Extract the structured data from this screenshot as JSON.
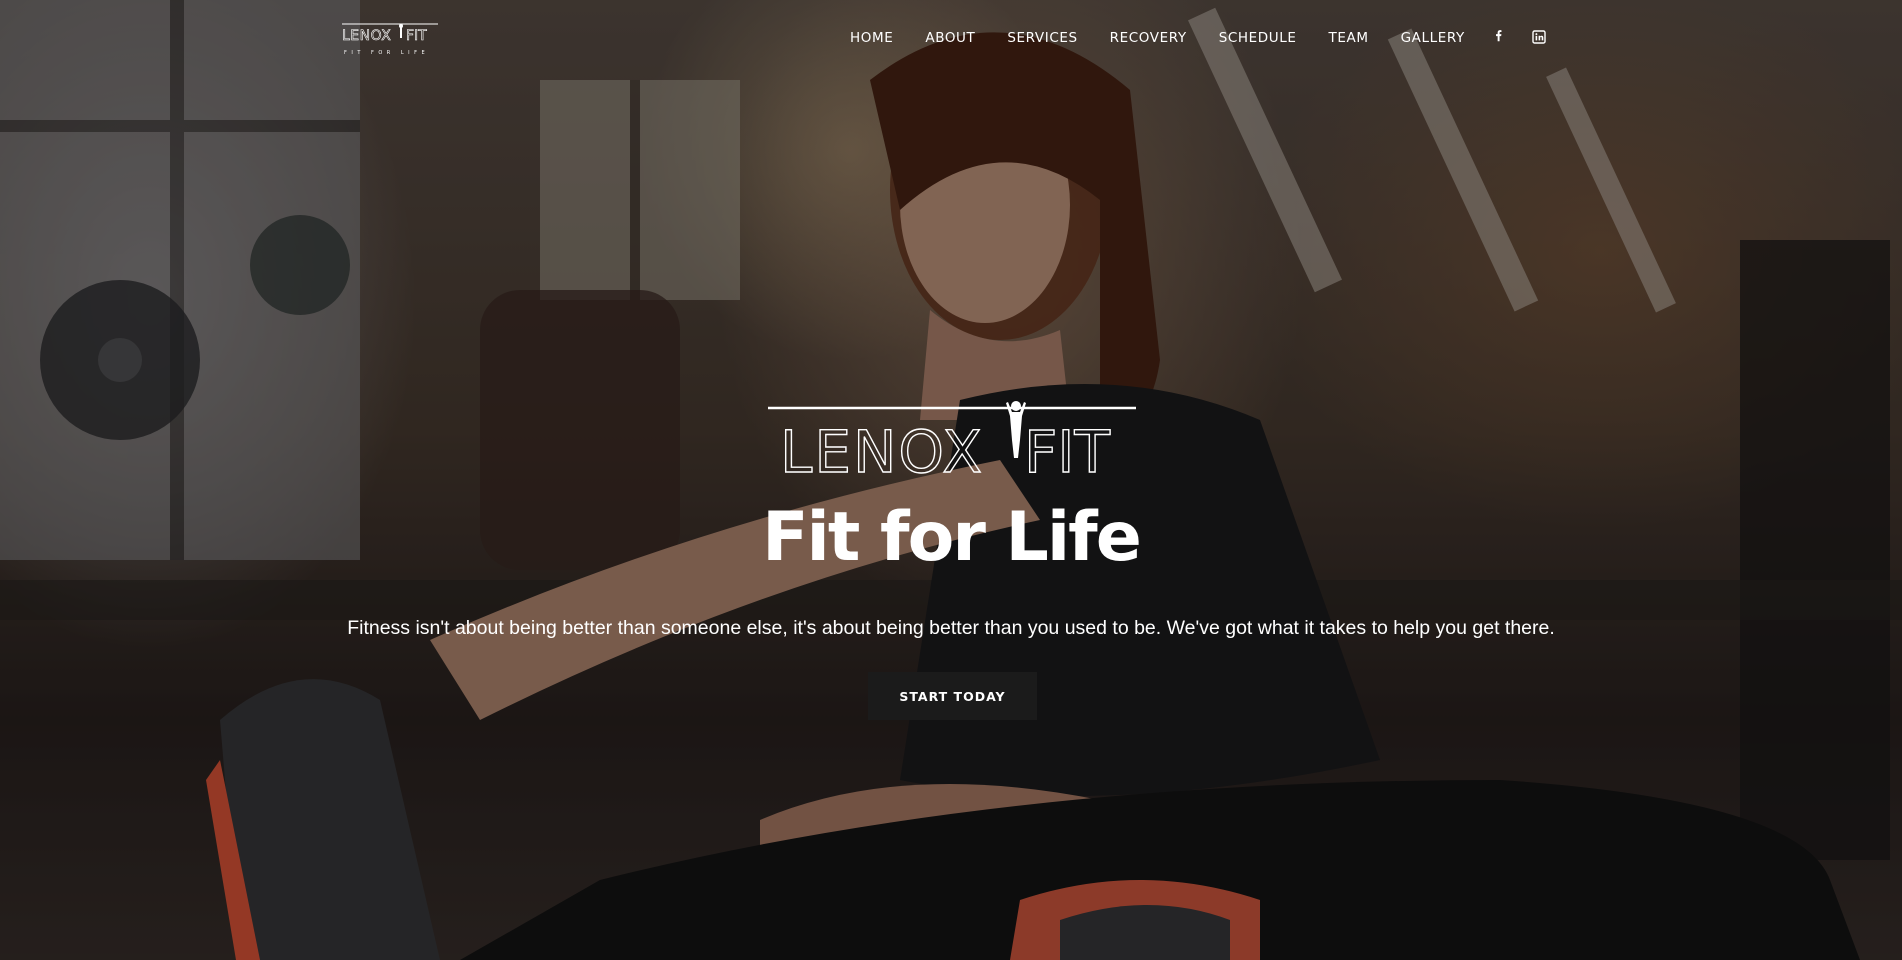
{
  "brand": {
    "logo_text": "LENOX FIT",
    "logo_tagline": "FIT FOR LIFE"
  },
  "nav": {
    "items": [
      {
        "label": "HOME"
      },
      {
        "label": "ABOUT"
      },
      {
        "label": "SERVICES"
      },
      {
        "label": "RECOVERY"
      },
      {
        "label": "SCHEDULE"
      },
      {
        "label": "TEAM"
      },
      {
        "label": "GALLERY"
      }
    ]
  },
  "social": {
    "icons": [
      "facebook-icon",
      "linkedin-icon"
    ]
  },
  "hero": {
    "logo_text": "LENOX FIT",
    "headline": "Fit for Life",
    "tagline": "Fitness isn't about being better than someone else, it's about being better than you used to be. We've got what it takes to help you get there.",
    "cta_label": "START TODAY"
  },
  "colors": {
    "button_bg": "#1b1b1b",
    "text": "#ffffff"
  }
}
